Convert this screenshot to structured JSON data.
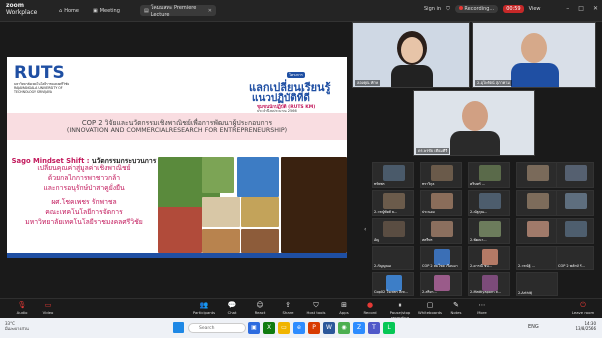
{
  "topbar": {
    "brand_line1": "zoom",
    "brand_line2": "Workplace",
    "tabs": [
      {
        "label": "Home",
        "icon": "home-icon"
      },
      {
        "label": "Meeting",
        "icon": "camera-icon"
      },
      {
        "label": "โคมมสทะ Premiere Lecture",
        "icon": "doc-icon",
        "close": "✕"
      }
    ],
    "sign_in": "Sign in",
    "recording": "Recording...",
    "timer": "00:59",
    "view": "View",
    "window_controls": [
      "–",
      "□",
      "✕"
    ]
  },
  "slide": {
    "logo": "RUTS",
    "logo_sub": "มหาวิทยาลัยเทคโนโลยีราชมงคลศรีวิชัย RAJAMANGALA UNIVERSITY OF TECHNOLOGY SRIVIJAYA",
    "banner_tag": "โครงการ",
    "banner_line1": "แลกเปลี่ยนเรียนรู้",
    "banner_line2": "แนวปฏิบัติที่ดี",
    "banner_line3": "ชุมชนนักปฏิบัติ (RUTS KM)",
    "banner_line4": "ประจำปีงบประมาณ 2566",
    "cop_line1": "COP 2 วิจัยและนวัตกรรมเชิงพาณิชย์เพื่อการพัฒนาผู้ประกอบการ",
    "cop_line2": "(INNOVATION AND COMMERCIALRESEARCH FOR ENTREPRENEURSHIP)",
    "sago_title": "Sago Mindset Shift :",
    "sago_lines": [
      "นวัตกรรมกระบวนการ",
      "เปลี่ยนคุณค่าสู่มูลค่าเชิงพาณิชย์",
      "ด้วยกลไกการพาชาวกล้า",
      "และการอนุรักษ์ป่าสาคูยั่งยืน"
    ],
    "author_lines": [
      "ผศ.โชคเพชร รักพาชล",
      "คณะเทคโนโลยีการจัดการ",
      "มหาวิทยาลัยเทคโนโลยีราชมงคลศรีวิชัย"
    ]
  },
  "speakers": [
    {
      "name": "ลองคุณ ทักษ",
      "role": "top-left"
    },
    {
      "name": "2-อุไพรัตน์ สุภาคาม",
      "role": "top-right"
    },
    {
      "name": "ดร.พรชัย เทียมคีรี",
      "role": "center"
    }
  ],
  "gallery": {
    "row1": [
      "ทรัพพร",
      "ทราวิกุล",
      "ครินทร์ ..."
    ],
    "row2": [
      "2-วรญ์ทัยส์ ธ...",
      "ประนอม",
      "2-ณัฐกุณ..."
    ],
    "row3": [
      "อัญ",
      "สตรีพร",
      "2-พัฒนา..."
    ],
    "row4": [
      "ทรงชาติ...",
      "ประสิทธิ์",
      "COP 2 พลักษ์ รั..."
    ],
    "row5": [
      "2-กัญญณอ",
      "COP 2 สมโชค เรือนมา",
      "2-ดารณี ชน...",
      "2-วรณัฐ์ ...",
      "COP 2 พลักษ์ รั..."
    ],
    "row6": [
      "Cop02 ใจเพชร ลีเท...",
      "2-สริยา...",
      "2-Mattiyaporn ส...",
      "2-ArthitJ"
    ],
    "row7": [
      "Cop02 ณัฐลินุ ...",
      "2-ArthitJ"
    ],
    "page_prev": "‹",
    "page_next": "›",
    "page_indicator": "1/2"
  },
  "toolbar": {
    "items": [
      {
        "label": "Audio",
        "icon": "mic-muted-icon"
      },
      {
        "label": "Video",
        "icon": "video-off-icon"
      },
      {
        "label": "Participants",
        "icon": "participants-icon"
      },
      {
        "label": "Chat",
        "icon": "chat-icon"
      },
      {
        "label": "React",
        "icon": "react-icon"
      },
      {
        "label": "Share",
        "icon": "share-icon"
      },
      {
        "label": "Host tools",
        "icon": "shield-icon"
      },
      {
        "label": "Apps",
        "icon": "apps-icon"
      },
      {
        "label": "Record",
        "icon": "record-icon"
      },
      {
        "label": "Pause/stop recording",
        "icon": "pause-icon"
      },
      {
        "label": "Whiteboards",
        "icon": "whiteboard-icon"
      },
      {
        "label": "Notes",
        "icon": "notes-icon"
      },
      {
        "label": "More",
        "icon": "more-icon"
      }
    ],
    "leave_label": "Leave room",
    "leave_icon": "leave-icon"
  },
  "taskbar": {
    "weather_temp": "33°C",
    "weather_desc": "มีเมฆบางส่วน",
    "search_placeholder": "Search",
    "time": "14:30",
    "date": "13/8/2566",
    "lang": "ENG"
  },
  "colors": {
    "bg": "#1a1a1a",
    "slide_blue": "#1f4fa3",
    "slide_pink": "#f9dde1",
    "accent_magenta": "#c2185b",
    "rec_red": "#e53935"
  }
}
